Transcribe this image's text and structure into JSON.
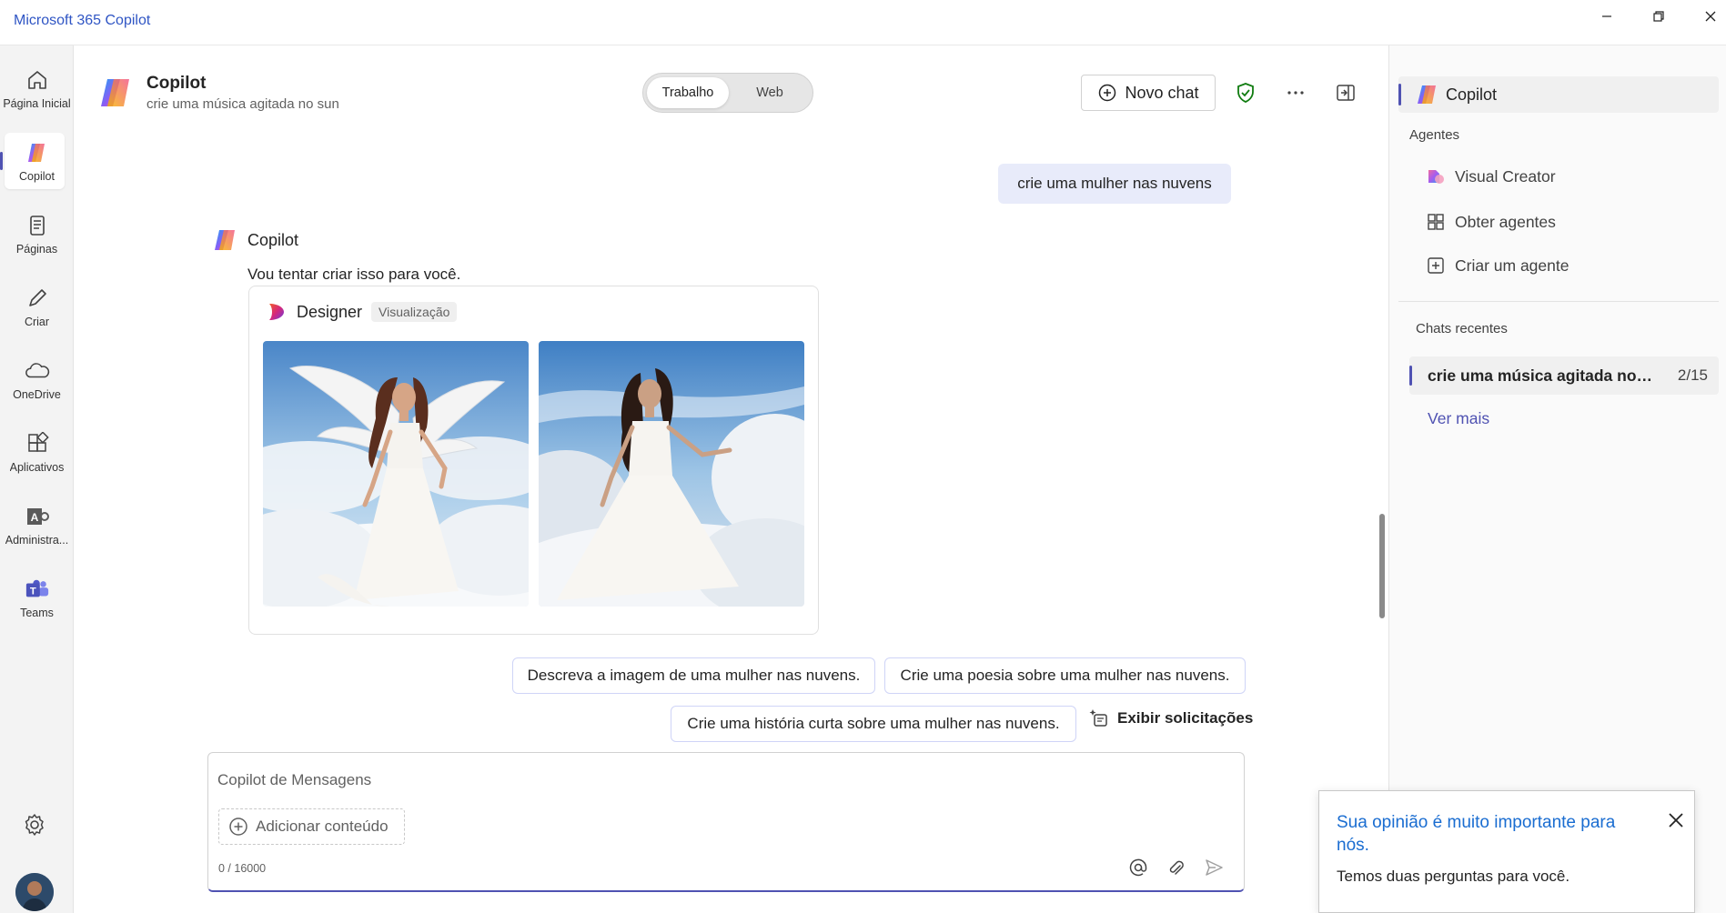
{
  "window": {
    "title": "Microsoft 365 Copilot"
  },
  "rail": {
    "items": [
      {
        "label": "Página Inicial",
        "icon": "home-icon"
      },
      {
        "label": "Copilot",
        "icon": "copilot-icon",
        "active": true
      },
      {
        "label": "Páginas",
        "icon": "pages-icon"
      },
      {
        "label": "Criar",
        "icon": "create-icon"
      },
      {
        "label": "OneDrive",
        "icon": "onedrive-icon"
      },
      {
        "label": "Aplicativos",
        "icon": "apps-icon"
      },
      {
        "label": "Administra...",
        "icon": "admin-icon"
      },
      {
        "label": "Teams",
        "icon": "teams-icon"
      }
    ],
    "settings_icon": "gear-icon",
    "avatar_icon": "avatar"
  },
  "header": {
    "title": "Copilot",
    "subtitle": "crie uma música agitada no sun",
    "toggle": {
      "selected": "Trabalho",
      "other": "Web"
    },
    "new_chat_label": "Novo chat"
  },
  "chat": {
    "user_message": "crie uma mulher nas nuvens",
    "bot_name": "Copilot",
    "bot_text": "Vou tentar criar isso para você.",
    "designer": {
      "name": "Designer",
      "badge": "Visualização"
    },
    "suggestions": [
      "Descreva a imagem de uma mulher nas nuvens.",
      "Crie uma poesia sobre uma mulher nas nuvens.",
      "Crie uma história curta sobre uma mulher nas nuvens."
    ],
    "show_prompts_label": "Exibir solicitações"
  },
  "composer": {
    "placeholder": "Copilot de Mensagens",
    "add_content_label": "Adicionar conteúdo",
    "counter": "0 / 16000"
  },
  "right_pane": {
    "copilot_label": "Copilot",
    "agents_heading": "Agentes",
    "agents": [
      {
        "label": "Visual Creator",
        "icon": "visual-creator-icon"
      },
      {
        "label": "Obter agentes",
        "icon": "get-agents-icon"
      },
      {
        "label": "Criar um agente",
        "icon": "create-agent-icon"
      }
    ],
    "recent_heading": "Chats recentes",
    "recent": {
      "title": "crie uma música agitada no s...",
      "count": "2/15"
    },
    "see_more": "Ver mais"
  },
  "feedback": {
    "title": "Sua opinião é muito importante para nós.",
    "body": "Temos duas perguntas para você."
  },
  "colors": {
    "accent": "#4f52b2",
    "link": "#1a6dd1",
    "bubble": "#e8ebfa"
  }
}
